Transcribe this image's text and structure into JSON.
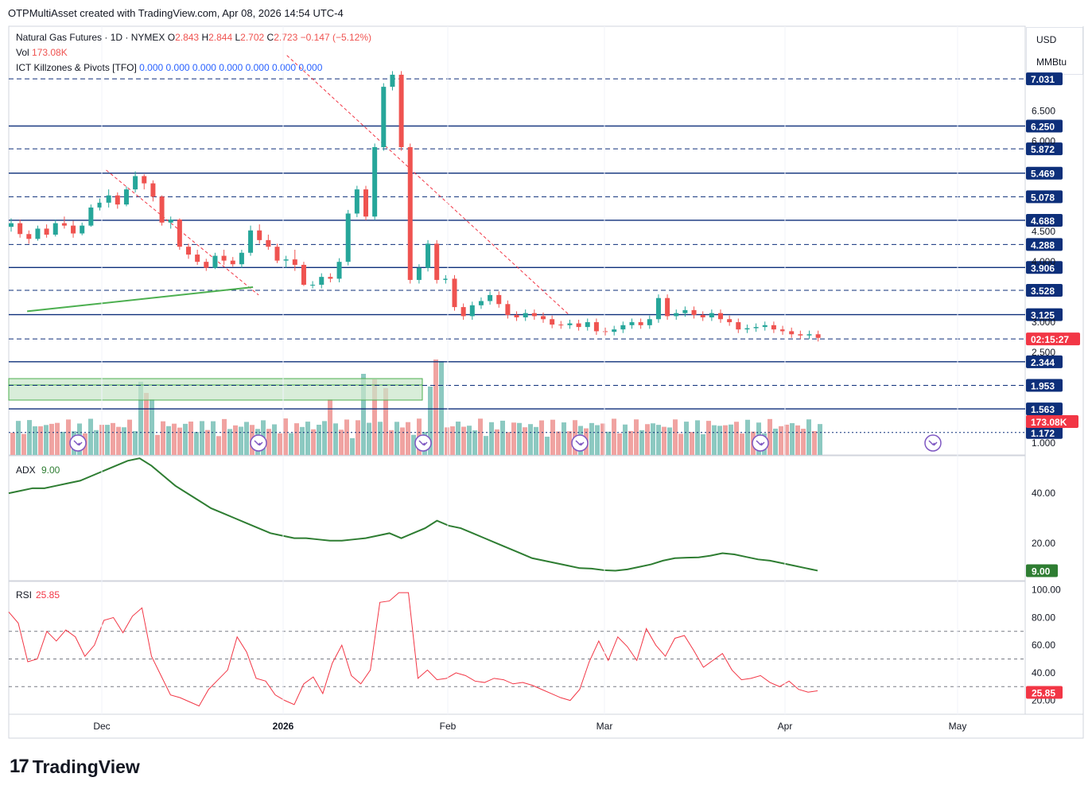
{
  "header": {
    "credit": "OTPMultiAsset created with TradingView.com, Apr 08, 2026 14:54 UTC-4"
  },
  "legend": {
    "symbol": "Natural Gas Futures · 1D · NYMEX",
    "o_label": "O",
    "o_value": "2.843",
    "h_label": "H",
    "h_value": "2.844",
    "l_label": "L",
    "l_value": "2.702",
    "c_label": "C",
    "c_value": "2.723",
    "change": "−0.147 (−5.12%)",
    "vol_label": "Vol",
    "vol_value": "173.08K",
    "indicator_label": "ICT Killzones & Pivots [TFO]",
    "indicator_values": [
      "0.000",
      "0.000",
      "0.000",
      "0.000",
      "0.000",
      "0.000",
      "0.000"
    ]
  },
  "units": {
    "currency": "USD",
    "unit": "MMBtu"
  },
  "colors": {
    "up": "#26a69a",
    "down": "#ef5350",
    "level": "#0d2f7a",
    "adx": "#2e7d32",
    "rsi": "#f23645",
    "trend_red": "#f23645",
    "trend_green": "#4caf50",
    "tag": "#0d2f7a",
    "countdown": "#f23645"
  },
  "icons": {
    "event_marker": "arrow-circle-icon"
  },
  "chart_data": [
    {
      "type": "candlestick",
      "name": "Natural Gas Futures · 1D · NYMEX",
      "ylim": [
        0.8,
        7.6
      ],
      "x_ticks": [
        "Dec",
        "2026",
        "Feb",
        "Mar",
        "Apr",
        "May"
      ],
      "y_ticks": [
        "1.000",
        "2.500",
        "3.000",
        "4.000",
        "4.500",
        "6.000",
        "6.500"
      ],
      "levels": [
        {
          "value": 7.031,
          "label": "7.031",
          "style": "dashed"
        },
        {
          "value": 6.25,
          "label": "6.250",
          "style": "solid"
        },
        {
          "value": 5.872,
          "label": "5.872",
          "style": "dashed"
        },
        {
          "value": 5.469,
          "label": "5.469",
          "style": "solid"
        },
        {
          "value": 5.078,
          "label": "5.078",
          "style": "dashed"
        },
        {
          "value": 4.688,
          "label": "4.688",
          "style": "solid"
        },
        {
          "value": 4.288,
          "label": "4.288",
          "style": "dashed"
        },
        {
          "value": 3.906,
          "label": "3.906",
          "style": "solid"
        },
        {
          "value": 3.528,
          "label": "3.528",
          "style": "dashed"
        },
        {
          "value": 3.125,
          "label": "3.125",
          "style": "solid"
        },
        {
          "value": 2.723,
          "label": "02:15:27",
          "style": "dashed"
        },
        {
          "value": 2.344,
          "label": "2.344",
          "style": "solid"
        },
        {
          "value": 1.953,
          "label": "1.953",
          "style": "dashed"
        },
        {
          "value": 1.563,
          "label": "1.563",
          "style": "solid"
        },
        {
          "value": 1.172,
          "label": "1.172",
          "style": "dotted"
        }
      ],
      "volume_label": "173.08K",
      "trendlines": [
        {
          "color": "red",
          "points": [
            [
              5,
              5.52
            ],
            [
              32,
              3.45
            ]
          ]
        },
        {
          "color": "red",
          "points": [
            [
              37,
              7.42
            ],
            [
              87,
              3.12
            ]
          ]
        },
        {
          "color": "green",
          "points": [
            [
              -9,
              3.18
            ],
            [
              31,
              3.58
            ]
          ]
        }
      ],
      "ohlc": [
        [
          4.58,
          4.72,
          4.5,
          4.64
        ],
        [
          4.64,
          4.7,
          4.4,
          4.46
        ],
        [
          4.46,
          4.52,
          4.3,
          4.38
        ],
        [
          4.38,
          4.6,
          4.35,
          4.55
        ],
        [
          4.55,
          4.62,
          4.4,
          4.45
        ],
        [
          4.45,
          4.7,
          4.42,
          4.64
        ],
        [
          4.64,
          4.75,
          4.55,
          4.6
        ],
        [
          4.6,
          4.68,
          4.4,
          4.47
        ],
        [
          4.47,
          4.65,
          4.44,
          4.6
        ],
        [
          4.6,
          4.95,
          4.58,
          4.9
        ],
        [
          4.9,
          5.05,
          4.85,
          4.98
        ],
        [
          4.98,
          5.2,
          4.9,
          5.1
        ],
        [
          5.1,
          5.15,
          4.88,
          4.95
        ],
        [
          4.95,
          5.25,
          4.92,
          5.2
        ],
        [
          5.2,
          5.5,
          5.15,
          5.42
        ],
        [
          5.42,
          5.45,
          5.2,
          5.3
        ],
        [
          5.3,
          5.35,
          5.0,
          5.08
        ],
        [
          5.08,
          5.1,
          4.6,
          4.65
        ],
        [
          4.65,
          4.75,
          4.55,
          4.7
        ],
        [
          4.7,
          4.72,
          4.2,
          4.25
        ],
        [
          4.25,
          4.3,
          4.05,
          4.12
        ],
        [
          4.12,
          4.2,
          3.95,
          4.0
        ],
        [
          4.0,
          4.05,
          3.85,
          3.9
        ],
        [
          3.9,
          4.15,
          3.88,
          4.1
        ],
        [
          4.1,
          4.2,
          3.95,
          4.02
        ],
        [
          4.02,
          4.08,
          3.92,
          3.96
        ],
        [
          3.96,
          4.2,
          3.9,
          4.15
        ],
        [
          4.15,
          4.6,
          4.1,
          4.52
        ],
        [
          4.52,
          4.62,
          4.3,
          4.36
        ],
        [
          4.36,
          4.45,
          4.2,
          4.25
        ],
        [
          4.25,
          4.3,
          3.98,
          4.02
        ],
        [
          4.02,
          4.1,
          3.9,
          4.04
        ],
        [
          4.04,
          4.2,
          3.85,
          3.95
        ],
        [
          3.95,
          4.0,
          3.6,
          3.62
        ]
      ]
    },
    {
      "type": "line",
      "name": "ADX",
      "label": "ADX",
      "current": "9.00",
      "ylim": [
        5,
        55
      ],
      "y_ticks": [
        "20.00",
        "40.00"
      ],
      "values": [
        40,
        41,
        42,
        42,
        43,
        44,
        45,
        47,
        49,
        51,
        53,
        54,
        51,
        47,
        43,
        40,
        37,
        34,
        32,
        30,
        28,
        26,
        24,
        23,
        22,
        22,
        21.5,
        21,
        21,
        21.5,
        22,
        23,
        24,
        22,
        24,
        26,
        29,
        27,
        26,
        24,
        22,
        20,
        18,
        16,
        14,
        13,
        12,
        11,
        10,
        9.8,
        9.2,
        9,
        9.5,
        10.5,
        11.5,
        13,
        14,
        14.2,
        14.3,
        15,
        16,
        15.5,
        14.5,
        13.5,
        13,
        12,
        11,
        10,
        9
      ]
    },
    {
      "type": "line",
      "name": "RSI",
      "label": "RSI",
      "current": "25.85",
      "ylim": [
        10,
        105
      ],
      "y_ticks": [
        "20.00",
        "40.00",
        "60.00",
        "80.00",
        "100.00"
      ],
      "bands": [
        70,
        50,
        30
      ],
      "values": [
        84,
        76,
        48,
        50,
        70,
        63,
        71,
        66,
        52,
        60,
        78,
        80,
        69,
        81,
        87,
        52,
        38,
        24,
        22,
        19,
        16,
        28,
        35,
        42,
        66,
        55,
        36,
        34,
        24,
        20,
        17,
        32,
        37,
        25,
        47,
        60,
        38,
        32,
        42,
        91,
        92,
        98,
        98,
        36,
        42,
        35,
        36,
        40,
        38,
        34,
        33,
        36,
        35,
        32,
        33,
        31,
        28,
        25,
        22,
        20,
        28,
        48,
        63,
        49,
        66,
        59,
        49,
        72,
        60,
        52,
        65,
        67,
        56,
        44,
        49,
        54,
        42,
        35,
        36,
        38,
        33,
        30,
        34,
        28,
        26,
        27
      ]
    }
  ],
  "x_axis": {
    "labels": [
      "Dec",
      "2026",
      "Feb",
      "Mar",
      "Apr",
      "May"
    ]
  },
  "brand": {
    "logo_text": "TradingView"
  }
}
